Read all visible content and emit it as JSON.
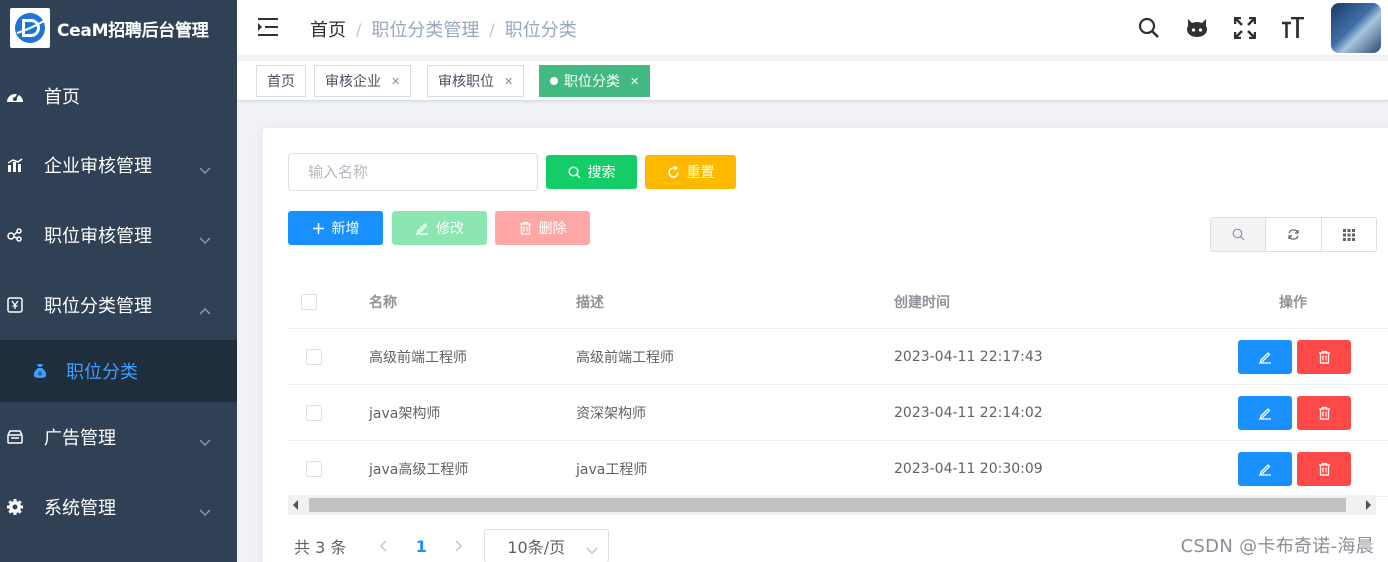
{
  "app": {
    "title": "CeaM招聘后台管理"
  },
  "sidebar": {
    "items": [
      {
        "label": "首页",
        "icon": "dashboard-icon"
      },
      {
        "label": "企业审核管理",
        "icon": "chart-icon"
      },
      {
        "label": "职位审核管理",
        "icon": "share-icon"
      },
      {
        "label": "职位分类管理",
        "icon": "money-icon",
        "expanded": true
      },
      {
        "label": "广告管理",
        "icon": "shop-icon"
      },
      {
        "label": "系统管理",
        "icon": "gear-icon"
      }
    ],
    "subitem": {
      "label": "职位分类",
      "icon": "money-bag-icon"
    }
  },
  "breadcrumb": [
    "首页",
    "职位分类管理",
    "职位分类"
  ],
  "tags": [
    {
      "label": "首页"
    },
    {
      "label": "审核企业"
    },
    {
      "label": "审核职位"
    },
    {
      "label": "职位分类",
      "active": true
    }
  ],
  "search": {
    "placeholder": "输入名称",
    "search_label": "搜索",
    "reset_label": "重置"
  },
  "toolbar": {
    "add_label": "新增",
    "edit_label": "修改",
    "delete_label": "删除"
  },
  "table": {
    "headers": [
      "名称",
      "描述",
      "创建时间",
      "操作"
    ],
    "rows": [
      {
        "name": "高级前端工程师",
        "desc": "高级前端工程师",
        "time": "2023-04-11 22:17:43"
      },
      {
        "name": "java架构师",
        "desc": "资深架构师",
        "time": "2023-04-11 22:14:02"
      },
      {
        "name": "java高级工程师",
        "desc": "java工程师",
        "time": "2023-04-11 20:30:09"
      }
    ]
  },
  "pagination": {
    "total": "共 3 条",
    "current": "1",
    "page_size": "10条/页"
  },
  "watermark": "CSDN @卡布奇诺-海晨",
  "colors": {
    "sidebar": "#304156",
    "primary": "#1890ff",
    "success": "#13ce66",
    "warning": "#ffba00",
    "danger": "#ff4949",
    "tag_active": "#42b983"
  }
}
